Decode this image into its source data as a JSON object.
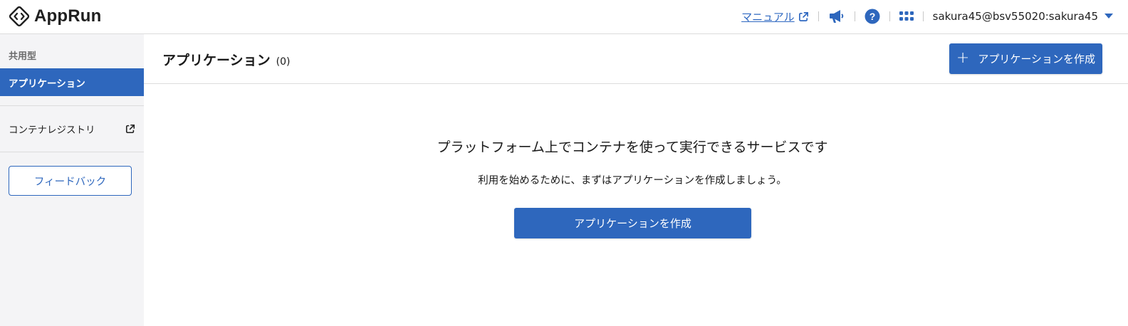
{
  "header": {
    "app_name": "AppRun",
    "manual_label": "マニュアル",
    "user_label": "sakura45@bsv55020:sakura45",
    "icons": {
      "logo": "apprun-logo-icon",
      "manual": "external-link-icon",
      "announce": "megaphone-icon",
      "help": "help-circle-icon",
      "apps": "grid-icon",
      "user_menu": "caret-down-icon"
    }
  },
  "sidebar": {
    "section_label": "共用型",
    "active_item": "アプリケーション",
    "registry_label": "コンテナレジストリ",
    "feedback_label": "フィードバック"
  },
  "main": {
    "title": "アプリケーション",
    "count": "(0)",
    "create_button_label": "アプリケーションを作成",
    "empty_title": "プラットフォーム上でコンテナを使って実行できるサービスです",
    "empty_subtitle": "利用を始めるために、まずはアプリケーションを作成しましょう。",
    "empty_button_label": "アプリケーションを作成"
  },
  "colors": {
    "accent": "#2e67bd",
    "link": "#2f68c1",
    "sidebar_bg": "#f4f4f6"
  }
}
